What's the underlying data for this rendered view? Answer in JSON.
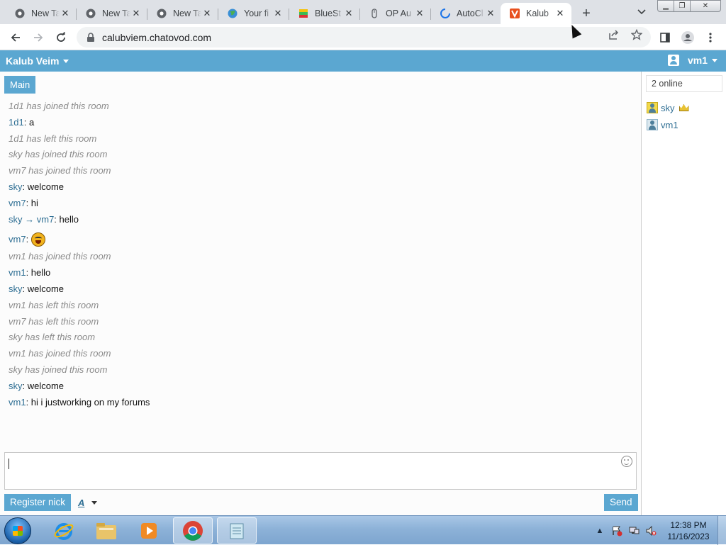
{
  "browser": {
    "tabs": [
      {
        "title": "New Tab",
        "icon": "chrome-icon",
        "active": false
      },
      {
        "title": "New Tab",
        "icon": "chrome-icon",
        "active": false
      },
      {
        "title": "New Tab",
        "icon": "chrome-icon",
        "active": false
      },
      {
        "title": "Your fi",
        "icon": "globe-icon",
        "active": false
      },
      {
        "title": "BlueSt",
        "icon": "bluestacks-icon",
        "active": false
      },
      {
        "title": "OP Au",
        "icon": "mouse-icon",
        "active": false
      },
      {
        "title": "AutoCl",
        "icon": "loading-icon",
        "active": false
      },
      {
        "title": "Kalub",
        "icon": "chatovod-icon",
        "active": true
      }
    ],
    "url": "calubviem.chatovod.com"
  },
  "chat": {
    "room_name": "Kalub Veim",
    "current_user": "vm1",
    "room_tab": "Main",
    "messages": [
      {
        "type": "sys",
        "text": "1d1 has joined this room"
      },
      {
        "type": "msg",
        "nick": "1d1",
        "text": "a"
      },
      {
        "type": "sys",
        "text": "1d1 has left this room"
      },
      {
        "type": "sys",
        "text": "sky has joined this room"
      },
      {
        "type": "sys",
        "text": "vm7 has joined this room"
      },
      {
        "type": "msg",
        "nick": "sky",
        "text": "welcome"
      },
      {
        "type": "msg",
        "nick": "vm7",
        "text": "hi"
      },
      {
        "type": "pm",
        "nick": "sky",
        "to": "vm7",
        "text": "hello"
      },
      {
        "type": "emoji",
        "nick": "vm7",
        "emoji": "laughing-emoji"
      },
      {
        "type": "sys",
        "text": "vm1 has joined this room"
      },
      {
        "type": "msg",
        "nick": "vm1",
        "text": "hello"
      },
      {
        "type": "msg",
        "nick": "sky",
        "text": "welcome"
      },
      {
        "type": "sys",
        "text": "vm1 has left this room"
      },
      {
        "type": "sys",
        "text": "vm7 has left this room"
      },
      {
        "type": "sys",
        "text": "sky has left this room"
      },
      {
        "type": "sys",
        "text": "vm1 has joined this room"
      },
      {
        "type": "sys",
        "text": "sky has joined this room"
      },
      {
        "type": "msg",
        "nick": "sky",
        "text": "welcome"
      },
      {
        "type": "msg",
        "nick": "vm1",
        "text": "hi i justworking on my forums"
      }
    ],
    "register_label": "Register nick",
    "format_label": "A",
    "send_label": "Send",
    "online_count": "2 online",
    "users": [
      {
        "nick": "sky",
        "admin": true
      },
      {
        "nick": "vm1",
        "admin": false
      }
    ],
    "accent_color": "#5ba7d1"
  },
  "taskbar": {
    "time": "12:38 PM",
    "date": "11/16/2023",
    "apps": [
      "ie-icon",
      "file-explorer-icon",
      "media-player-icon",
      "chrome-icon",
      "notepad-icon"
    ]
  }
}
